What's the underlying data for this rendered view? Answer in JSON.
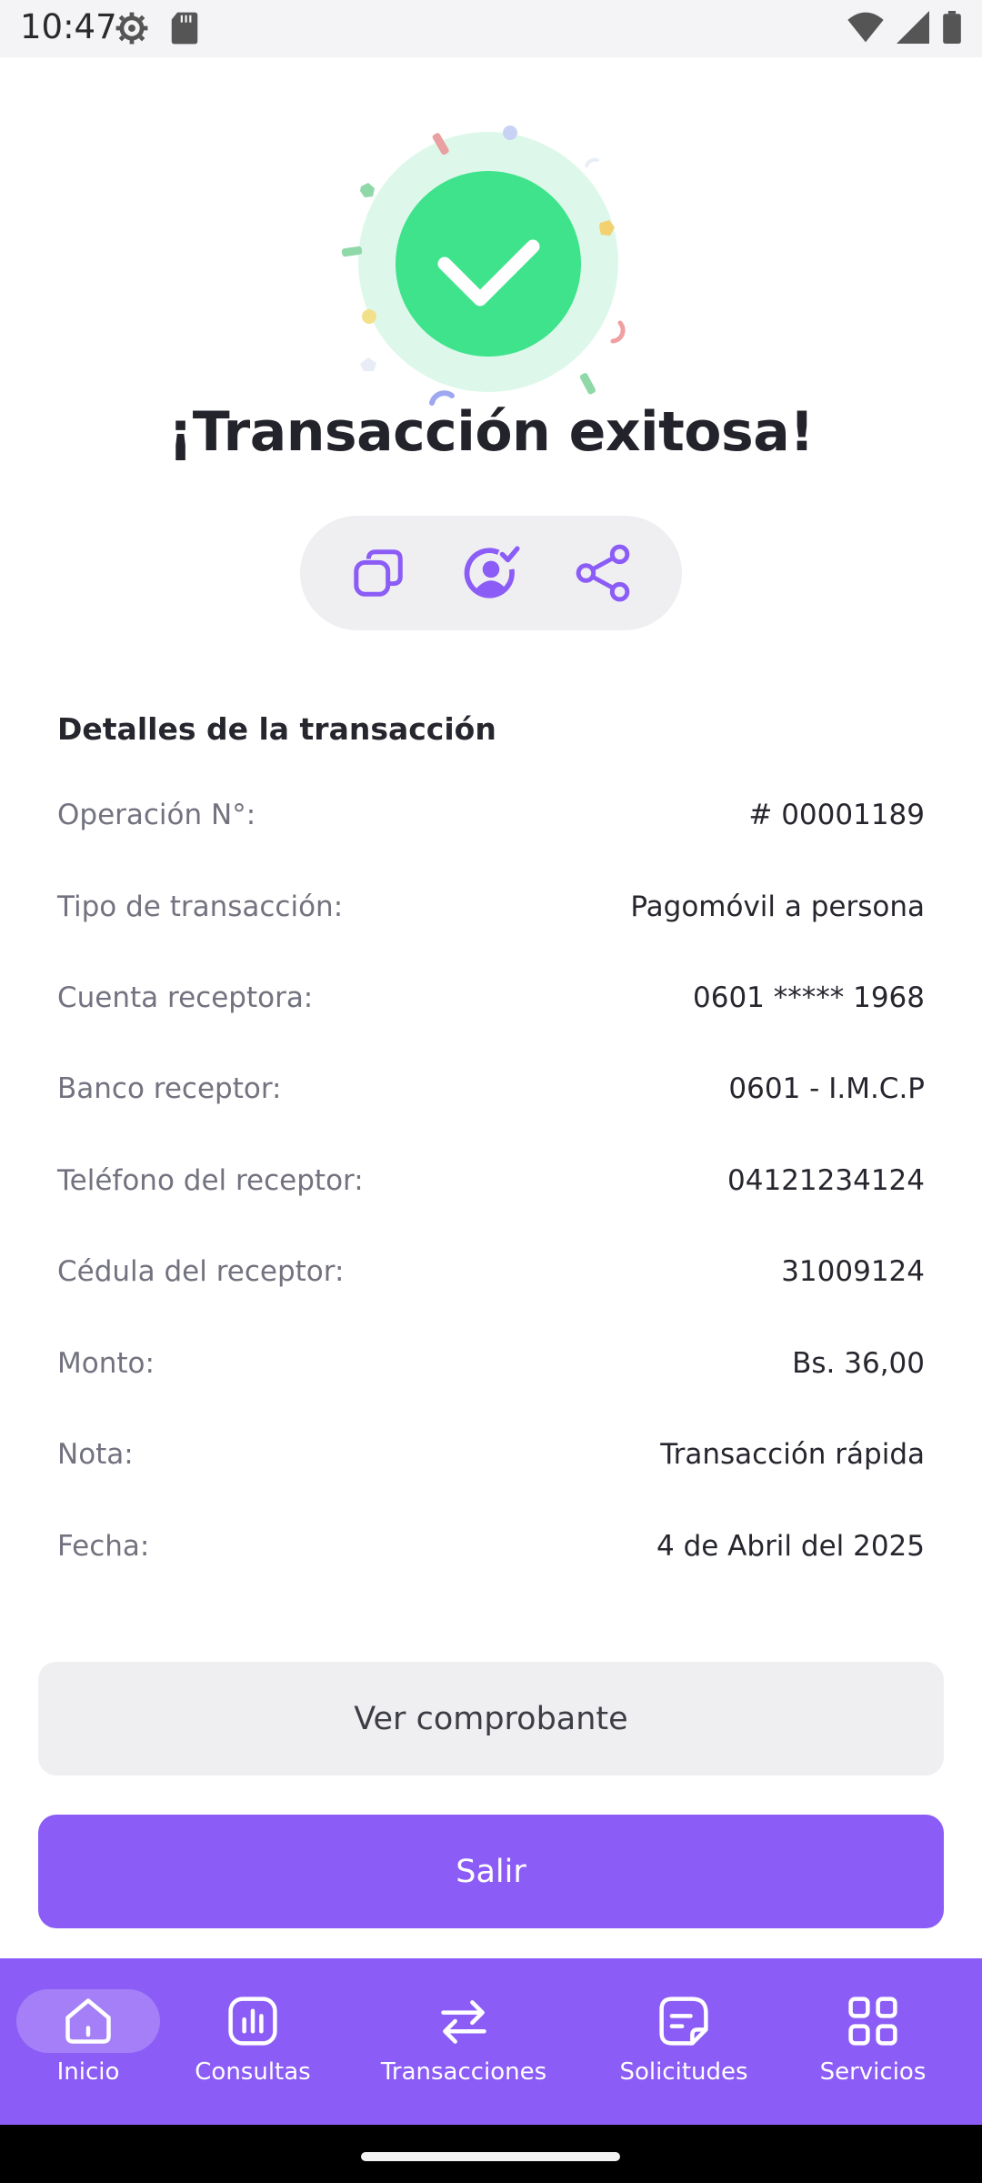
{
  "status_bar": {
    "time": "10:47"
  },
  "title": "¡Transacción exitosa!",
  "colors": {
    "accent": "#8B5CF6",
    "success": "#3FE38C",
    "success_halo": "#DDF8EA"
  },
  "actions": [
    {
      "icon": "copy-icon"
    },
    {
      "icon": "add-contact-icon"
    },
    {
      "icon": "share-icon"
    }
  ],
  "details": {
    "title": "Detalles de la transacción",
    "rows": [
      {
        "label": "Operación N°:",
        "value": "# 00001189"
      },
      {
        "label": "Tipo de transacción:",
        "value": "Pagomóvil a persona"
      },
      {
        "label": "Cuenta receptora:",
        "value": "0601 ***** 1968"
      },
      {
        "label": "Banco receptor:",
        "value": "0601 - I.M.C.P"
      },
      {
        "label": "Teléfono del receptor:",
        "value": "04121234124"
      },
      {
        "label": "Cédula del receptor:",
        "value": "31009124"
      },
      {
        "label": "Monto:",
        "value": "Bs. 36,00"
      },
      {
        "label": "Nota:",
        "value": "Transacción rápida"
      },
      {
        "label": "Fecha:",
        "value": "4 de Abril del 2025"
      }
    ]
  },
  "buttons": {
    "view_receipt": "Ver comprobante",
    "exit": "Salir"
  },
  "nav": {
    "items": [
      {
        "label": "Inicio",
        "icon": "home-icon",
        "active": true
      },
      {
        "label": "Consultas",
        "icon": "chart-icon",
        "active": false
      },
      {
        "label": "Transacciones",
        "icon": "transfer-arrows-icon",
        "active": false
      },
      {
        "label": "Solicitudes",
        "icon": "document-icon",
        "active": false
      },
      {
        "label": "Servicios",
        "icon": "grid-icon",
        "active": false
      }
    ]
  }
}
